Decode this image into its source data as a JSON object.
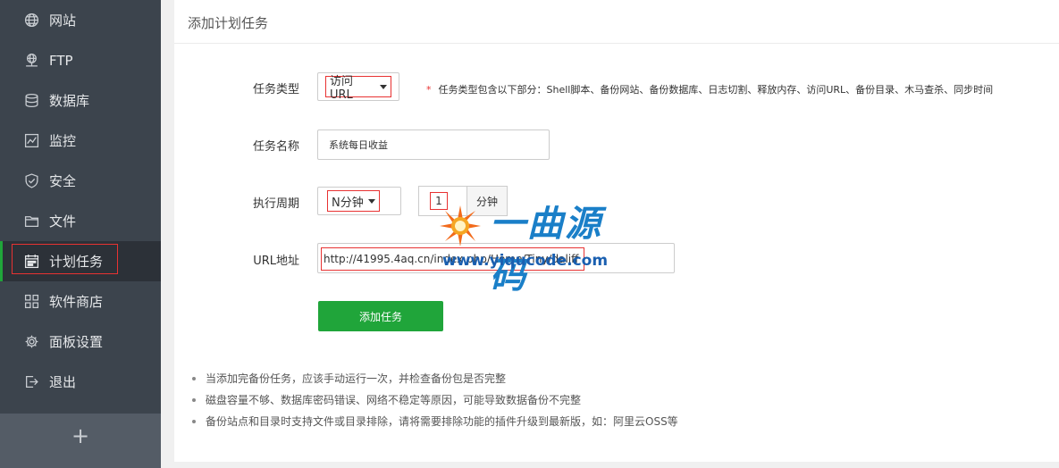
{
  "sidebar": {
    "items": [
      {
        "label": "网站",
        "icon": "globe-icon",
        "active": false
      },
      {
        "label": "FTP",
        "icon": "ftp-icon",
        "active": false
      },
      {
        "label": "数据库",
        "icon": "database-icon",
        "active": false
      },
      {
        "label": "监控",
        "icon": "monitor-icon",
        "active": false
      },
      {
        "label": "安全",
        "icon": "shield-icon",
        "active": false
      },
      {
        "label": "文件",
        "icon": "folder-icon",
        "active": false
      },
      {
        "label": "计划任务",
        "icon": "calendar-icon",
        "active": true
      },
      {
        "label": "软件商店",
        "icon": "grid-icon",
        "active": false
      },
      {
        "label": "面板设置",
        "icon": "gear-icon",
        "active": false
      },
      {
        "label": "退出",
        "icon": "logout-icon",
        "active": false
      }
    ],
    "add_label": "+"
  },
  "page": {
    "title": "添加计划任务"
  },
  "form": {
    "task_type": {
      "label": "任务类型",
      "value": "访问URL",
      "hint_star": "*",
      "hint": "任务类型包含以下部分：Shell脚本、备份网站、备份数据库、日志切割、释放内存、访问URL、备份目录、木马查杀、同步时间"
    },
    "task_name": {
      "label": "任务名称",
      "value": "系统每日收益"
    },
    "cycle": {
      "label": "执行周期",
      "value": "N分钟",
      "number": "1",
      "unit": "分钟"
    },
    "url": {
      "label": "URL地址",
      "value": "http://41995.4aq.cn/index.php/Home/Tiny/daliff"
    },
    "submit_label": "添加任务"
  },
  "notes": [
    "当添加完备份任务，应该手动运行一次，并检查备份包是否完整",
    "磁盘容量不够、数据库密码错误、网络不稳定等原因，可能导致数据备份不完整",
    "备份站点和目录时支持文件或目录排除，请将需要排除功能的插件升级到最新版，如：阿里云OSS等"
  ],
  "watermark": {
    "title": "一曲源码",
    "url": "www.yiqucode.com"
  },
  "colors": {
    "sidebar_bg": "#3c444d",
    "sidebar_active": "#2c3138",
    "accent_green": "#20a53a",
    "highlight_red": "#e83232"
  }
}
